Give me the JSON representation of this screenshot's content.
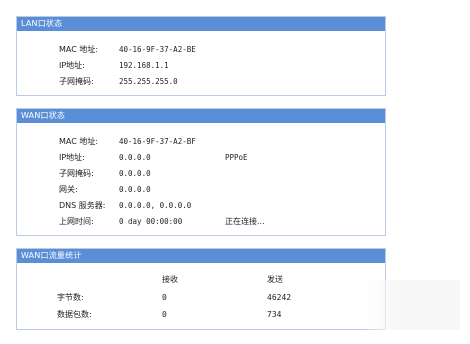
{
  "lan": {
    "title": "LAN口状态",
    "rows": [
      {
        "label": "MAC 地址:",
        "value": "40-16-9F-37-A2-BE"
      },
      {
        "label": "IP地址:",
        "value": "192.168.1.1"
      },
      {
        "label": "子网掩码:",
        "value": "255.255.255.0"
      }
    ]
  },
  "wan": {
    "title": "WAN口状态",
    "rows": [
      {
        "label": "MAC 地址:",
        "value": "40-16-9F-37-A2-BF",
        "extra": ""
      },
      {
        "label": "IP地址:",
        "value": "0.0.0.0",
        "extra": "PPPoE"
      },
      {
        "label": "子网掩码:",
        "value": "0.0.0.0",
        "extra": ""
      },
      {
        "label": "网关:",
        "value": "0.0.0.0",
        "extra": ""
      },
      {
        "label": "DNS 服务器:",
        "value": "0.0.0.0, 0.0.0.0",
        "extra": ""
      },
      {
        "label": "上网时间:",
        "value": "0 day 00:00:00",
        "extra": "正在连接..."
      }
    ]
  },
  "stats": {
    "title": "WAN口流量统计",
    "headers": {
      "recv": "接收",
      "send": "发送"
    },
    "rows": [
      {
        "label": "字节数:",
        "recv": "0",
        "send": "46242"
      },
      {
        "label": "数据包数:",
        "recv": "0",
        "send": "734"
      }
    ]
  }
}
